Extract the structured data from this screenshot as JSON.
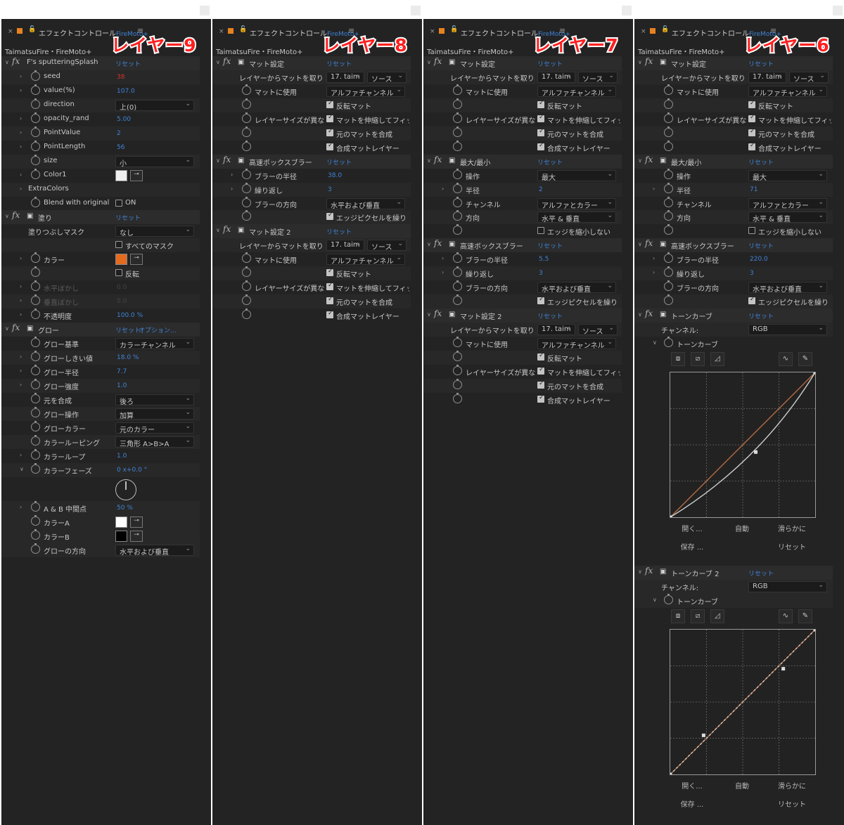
{
  "tab_title": "エフェクトコントロール",
  "tab_layer": "FireMoto+",
  "comp_label": "TaimatsuFire・FireMoto+",
  "reset": "リセット",
  "options": "オプション...",
  "panel_labels": [
    "レイヤー9",
    "レイヤー8",
    "レイヤー7",
    "レイヤー6"
  ],
  "icons": {
    "close": "close-icon",
    "lock": "lock-icon",
    "menu": "menu-icon",
    "stopwatch": "stopwatch-icon",
    "twirl": "chevron-icon",
    "eyedropper": "eyedropper-icon"
  },
  "colors": {
    "accent": "#3f83d6",
    "label_red": "#ff1f1f",
    "tab_orange": "#e8821e",
    "color1": "#f0f0f0",
    "fill_color": "#e36a1e",
    "color_a": "#ffffff",
    "color_b": "#000000",
    "curve_rgb": "#b36a40",
    "curve_white": "#cfcfcf"
  },
  "p1": {
    "fx1": "F's sputteringSplash",
    "seed_l": "seed",
    "seed_v": "38",
    "value_l": "value(%)",
    "value_v": "107.0",
    "direction_l": "direction",
    "direction_v": "上(0)",
    "opr_l": "opacity_rand",
    "opr_v": "5.00",
    "pv_l": "PointValue",
    "pv_v": "2",
    "pl_l": "PointLength",
    "pl_v": "56",
    "size_l": "size",
    "size_v": "小",
    "color1_l": "Color1",
    "extra_l": "ExtraColors",
    "blend_l": "Blend with original",
    "blend_v": "ON",
    "fx2": "塗り",
    "mask_l": "塗りつぶしマスク",
    "mask_v": "なし",
    "allmask": "すべてのマスク",
    "color_l": "カラー",
    "invert": "反転",
    "hblur_l": "水平ぼかし",
    "hblur_v": "0.0",
    "vblur_l": "垂直ぼかし",
    "vblur_v": "0.0",
    "op_l": "不透明度",
    "op_v": "100.0 %",
    "fx3": "グロー",
    "g_base_l": "グロー基準",
    "g_base_v": "カラーチャンネル",
    "g_thr_l": "グローしきい値",
    "g_thr_v": "18.0 %",
    "g_rad_l": "グロー半径",
    "g_rad_v": "7.7",
    "g_int_l": "グロー強度",
    "g_int_v": "1.0",
    "g_comp_l": "元を合成",
    "g_comp_v": "後ろ",
    "g_op_l": "グロー操作",
    "g_op_v": "加算",
    "g_col_l": "グローカラー",
    "g_col_v": "元のカラー",
    "g_loopm_l": "カラールーピング",
    "g_loopm_v": "三角形 A>B>A",
    "g_loop_l": "カラーループ",
    "g_loop_v": "1.0",
    "g_phase_l": "カラーフェーズ",
    "g_phase_v": "0 x+0.0 °",
    "g_ab_l": "A & B 中間点",
    "g_ab_v": "50 %",
    "g_ca_l": "カラーA",
    "g_cb_l": "カラーB",
    "g_dir_l": "グローの方向",
    "g_dir_v": "水平および垂直"
  },
  "p2": {
    "fx1": "マット設定",
    "take_l": "レイヤーからマットを取り",
    "take_v1": "17. taim",
    "take_v2": "ソース",
    "use_l": "マットに使用",
    "use_v": "アルファチャンネル",
    "inv": "反転マット",
    "size_l": "レイヤーサイズが異な",
    "size_v": "マットを伸縮してフィッ",
    "compo": "元のマットを合成",
    "prem": "合成マットレイヤー",
    "fx2": "高速ボックスブラー",
    "rad_l": "ブラーの半径",
    "rad_v": "38.0",
    "rep_l": "繰り返し",
    "rep_v": "3",
    "dir_l": "ブラーの方向",
    "dir_v": "水平および垂直",
    "edge": "エッジピクセルを繰り",
    "fx3": "マット設定 2"
  },
  "p3": {
    "fx2": "最大/最小",
    "op_l": "操作",
    "op_v": "最大",
    "rad_l": "半径",
    "rad_v": "2",
    "ch_l": "チャンネル",
    "ch_v": "アルファとカラー",
    "dir_l": "方向",
    "dir_v": "水平 & 垂直",
    "noshrink": "エッジを縮小しない",
    "rad2_v": "5.5"
  },
  "p4": {
    "rad_v": "71",
    "rad2_v": "220.0",
    "fx4": "トーンカーブ",
    "ch_l": "チャンネル:",
    "ch_v": "RGB",
    "tc_l": "トーンカーブ",
    "open": "開く...",
    "auto": "自動",
    "smooth": "滑らかに",
    "save": "保存 ...",
    "reset_btn": "リセット",
    "fx5": "トーンカーブ 2"
  }
}
